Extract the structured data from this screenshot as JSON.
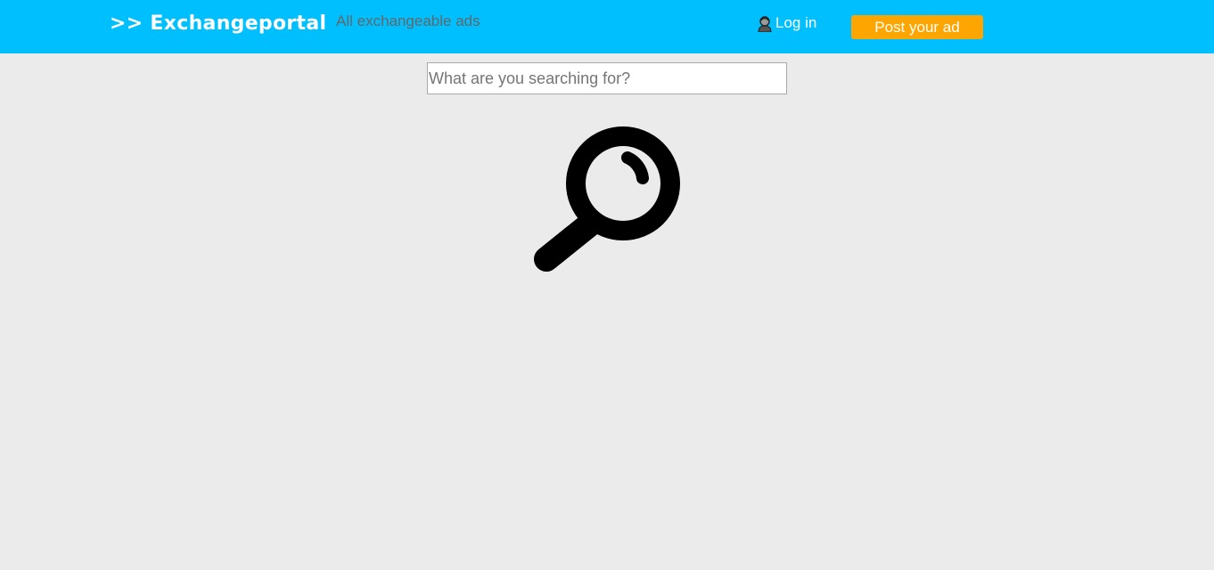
{
  "header": {
    "logo_text": ">> Exchangeportal",
    "nav_all_ads": "All exchangeable ads",
    "login_label": "Log in",
    "login_icon": "user-icon",
    "post_ad_label": "Post your ad"
  },
  "search": {
    "placeholder": "What are you searching for?",
    "value": "",
    "icon": "search-icon"
  },
  "colors": {
    "header_bg": "#00bfff",
    "page_bg": "#ebebeb",
    "post_button_bg": "#ffa500",
    "nav_link_text": "#666666"
  }
}
